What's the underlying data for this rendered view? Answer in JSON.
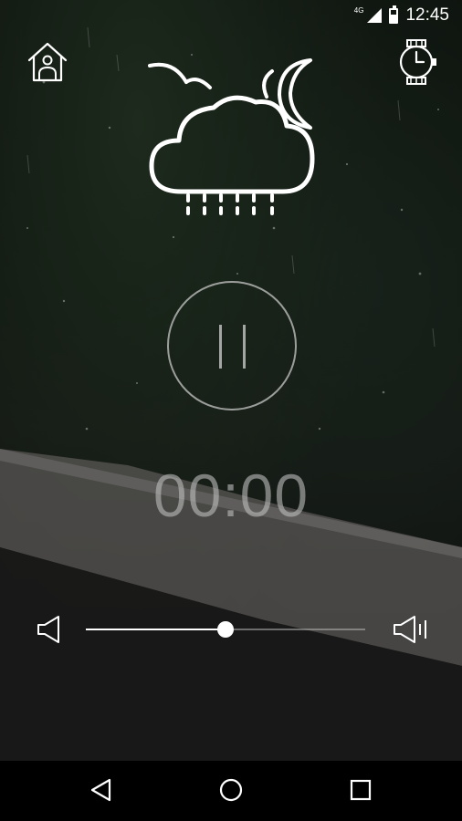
{
  "status_bar": {
    "network_label": "4G",
    "time": "12:45"
  },
  "header": {
    "home_icon": "home-icon",
    "timer_icon": "clock-timer-icon"
  },
  "weather": {
    "icon": "cloud-rain-moon-icon"
  },
  "player": {
    "state": "playing",
    "control_icon": "pause-icon",
    "timer_value": "00:00"
  },
  "volume": {
    "level": 0.5,
    "low_icon": "volume-low-icon",
    "high_icon": "volume-high-icon"
  },
  "nav_bar": {
    "back_icon": "back-triangle-icon",
    "home_icon": "home-circle-icon",
    "recents_icon": "recents-square-icon"
  },
  "colors": {
    "foreground": "#ffffff",
    "muted": "#bebebe",
    "nav_background": "#000000"
  }
}
